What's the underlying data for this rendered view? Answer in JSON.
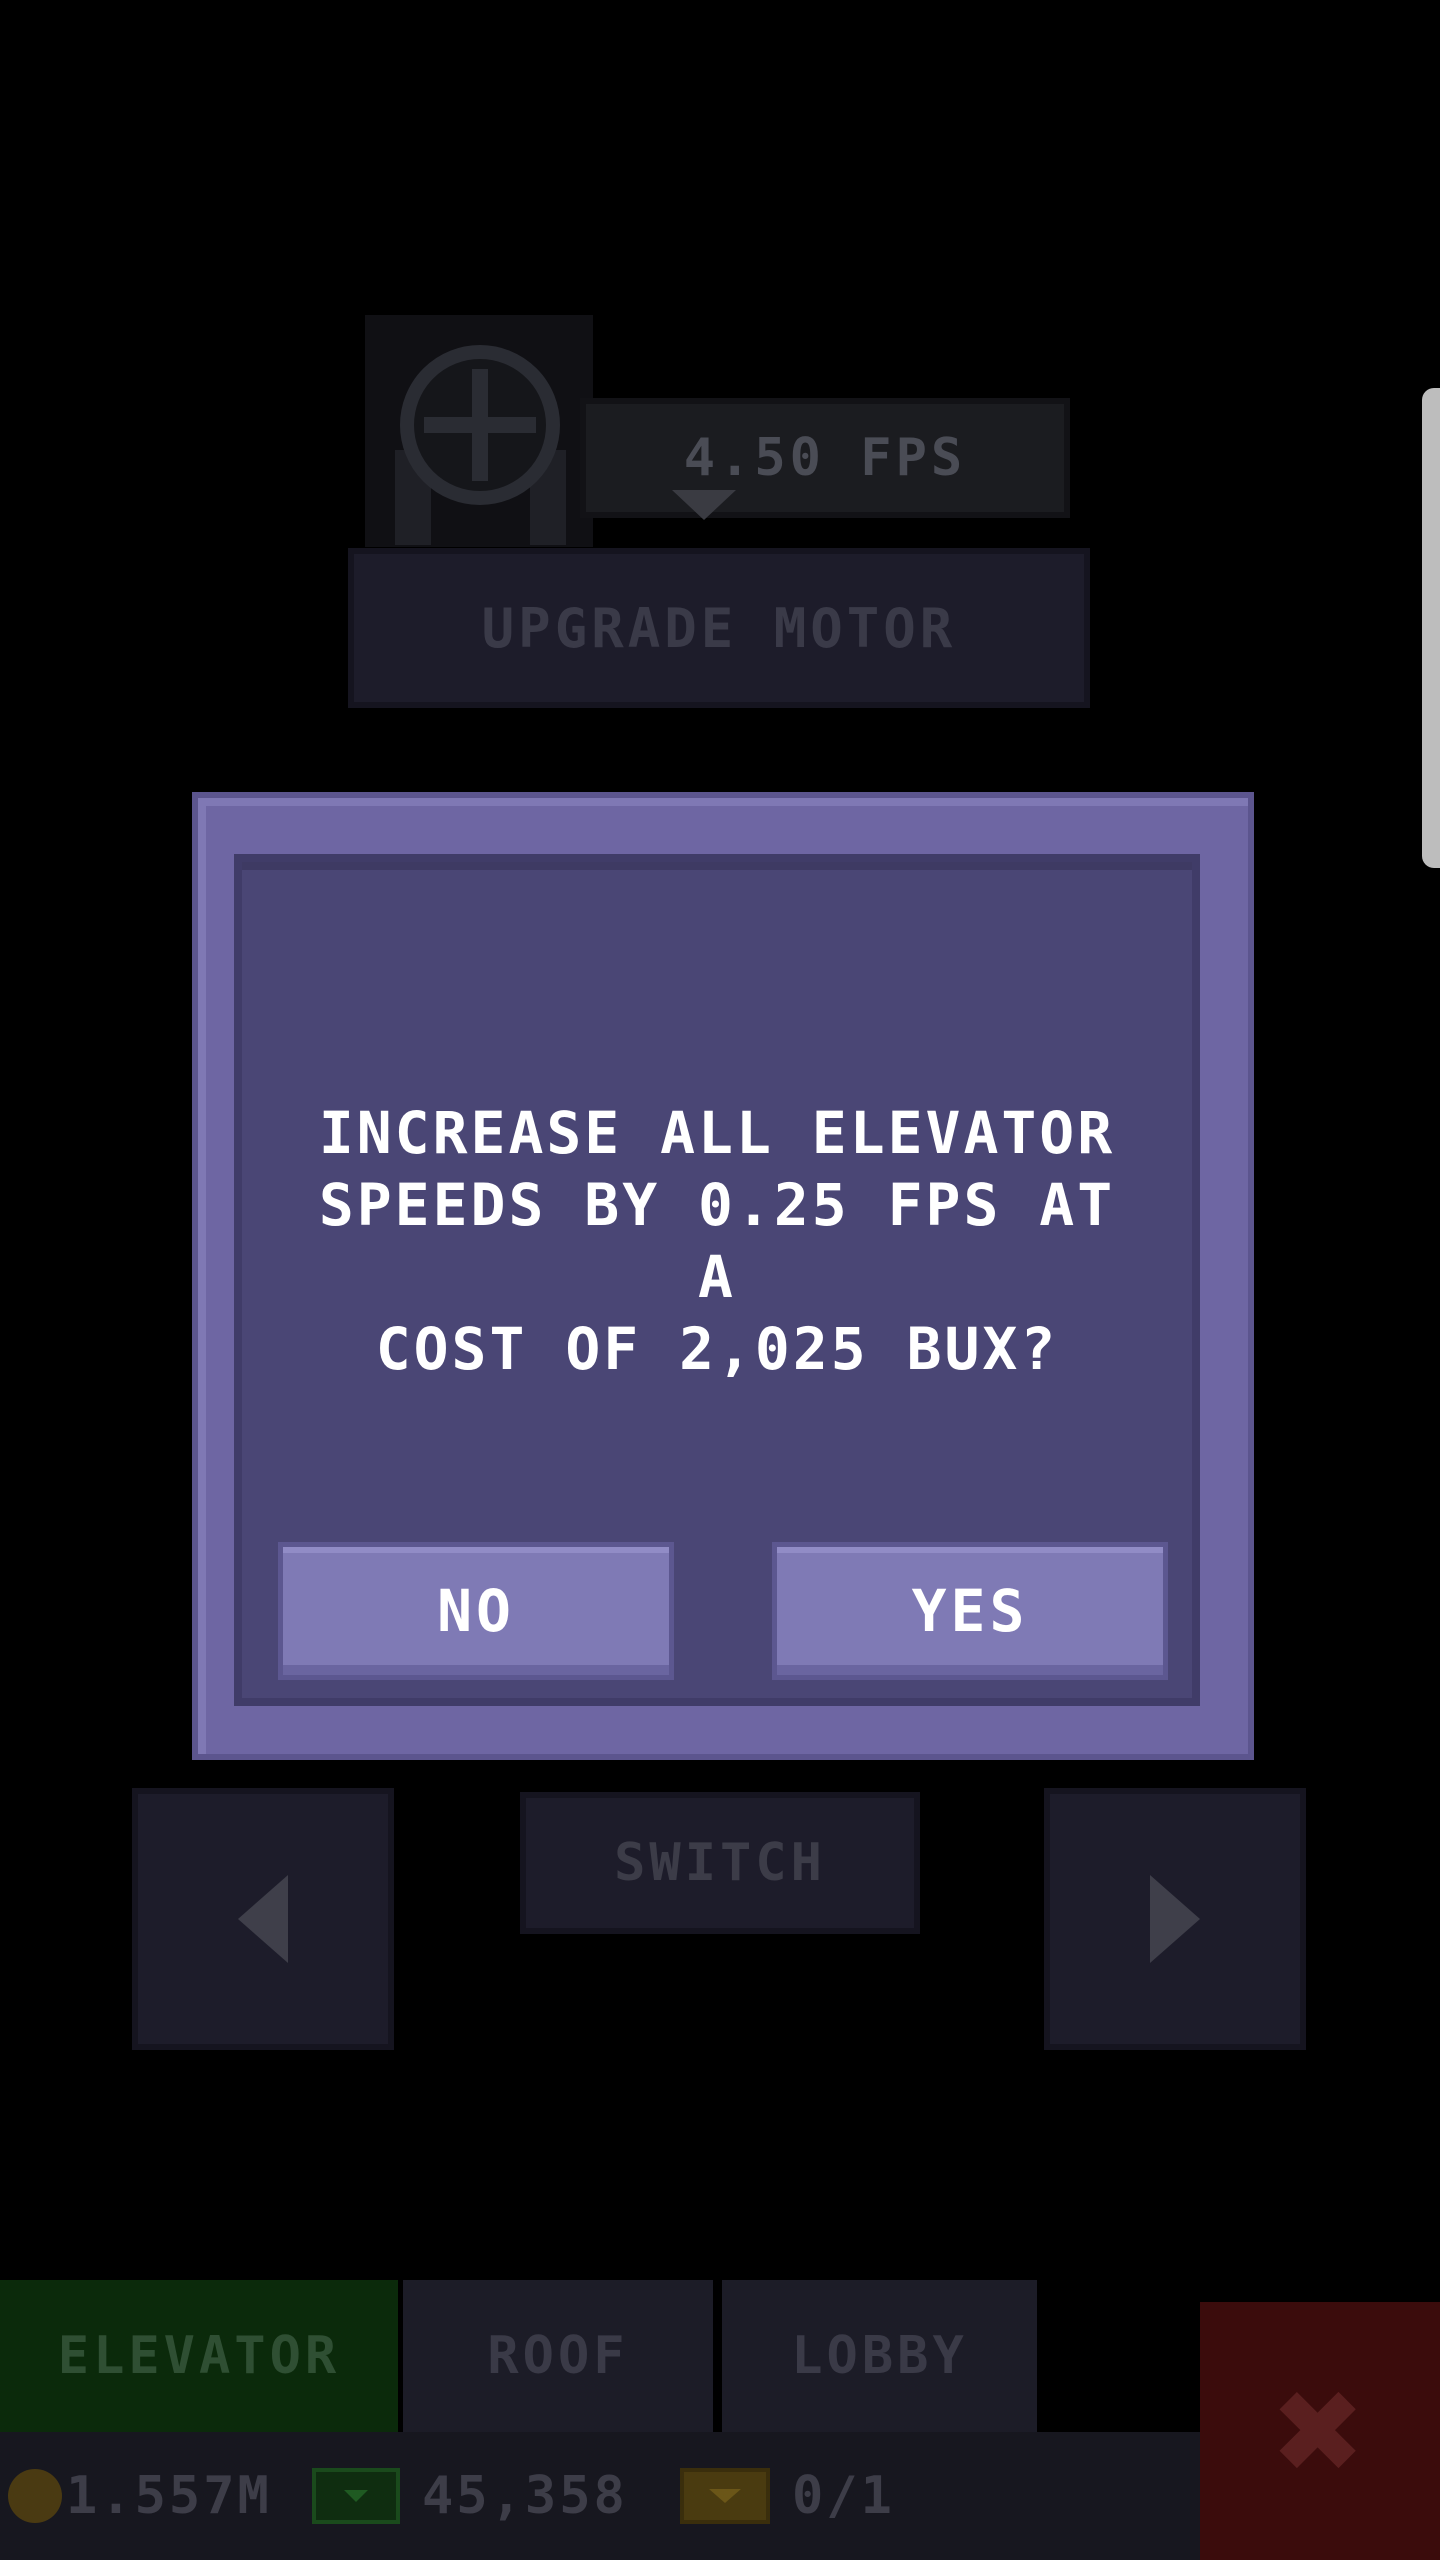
{
  "motor": {
    "speed_label": "4.50 FPS",
    "upgrade_label": "UPGRADE MOTOR"
  },
  "dialog": {
    "message": "INCREASE ALL ELEVATOR\nSPEEDS BY 0.25 FPS AT A\nCOST OF 2,025 BUX?",
    "no_label": "NO",
    "yes_label": "YES"
  },
  "navigation": {
    "switch_label": "SWITCH",
    "prev_icon": "arrow-left-icon",
    "next_icon": "arrow-right-icon"
  },
  "tabs": [
    {
      "label": "ELEVATOR",
      "active": true
    },
    {
      "label": "ROOF",
      "active": false
    },
    {
      "label": "LOBBY",
      "active": false
    }
  ],
  "status": {
    "coins": "1.557M",
    "bux": "45,358",
    "tickets": "0/1"
  },
  "colors": {
    "dialog_frame": "#6e66a3",
    "dialog_panel": "#4a4675",
    "dialog_button": "#7f7ab5",
    "active_tab": "#0b2a0b",
    "close_button": "#3b0c0c"
  },
  "icons": {
    "close": "close-x-icon",
    "coin": "coin-icon",
    "cash": "bux-cash-icon",
    "ticket": "ticket-icon"
  }
}
